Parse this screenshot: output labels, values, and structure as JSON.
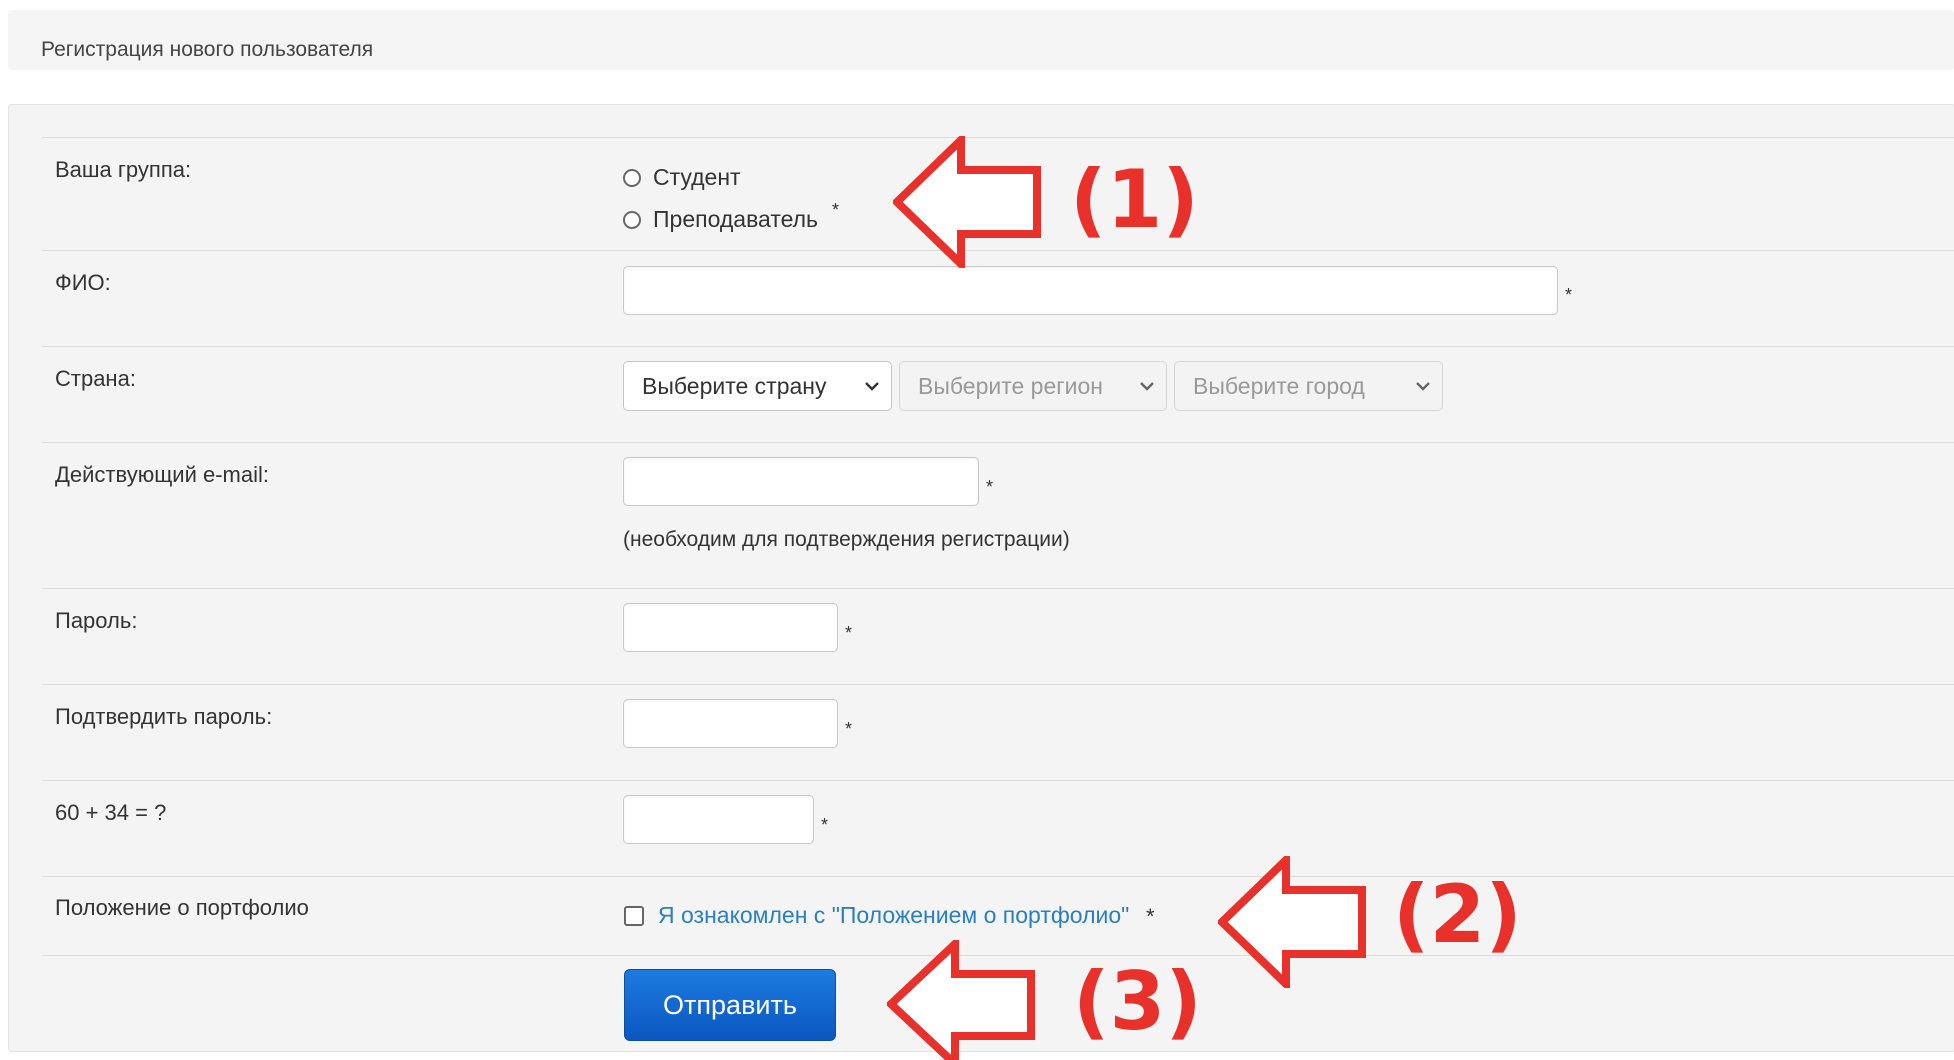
{
  "header": {
    "title": "Регистрация нового пользователя"
  },
  "form": {
    "group": {
      "label": "Ваша группа:",
      "options": [
        "Студент",
        "Преподаватель"
      ],
      "required": "*"
    },
    "fio": {
      "label": "ФИО:",
      "value": "",
      "required": "*"
    },
    "country": {
      "label": "Страна:",
      "country_select": "Выберите страну",
      "region_select": "Выберите регион",
      "city_select": "Выберите город"
    },
    "email": {
      "label": "Действующий e-mail:",
      "value": "",
      "required": "*",
      "hint": "(необходим для подтверждения регистрации)"
    },
    "password": {
      "label": "Пароль:",
      "value": "",
      "required": "*"
    },
    "password_confirm": {
      "label": "Подтвердить пароль:",
      "value": "",
      "required": "*"
    },
    "captcha": {
      "label": "60 + 34 = ?",
      "value": "",
      "required": "*"
    },
    "portfolio": {
      "label": "Положение о портфолио",
      "checkbox_text": "Я ознакомлен с \"Положением о портфолио\"",
      "required": "*"
    },
    "submit_label": "Отправить"
  },
  "annotations": [
    "(1)",
    "(2)",
    "(3)"
  ],
  "colors": {
    "arrow": "#e8312a",
    "link": "#2a7fc1",
    "button": "#0b56c2"
  }
}
